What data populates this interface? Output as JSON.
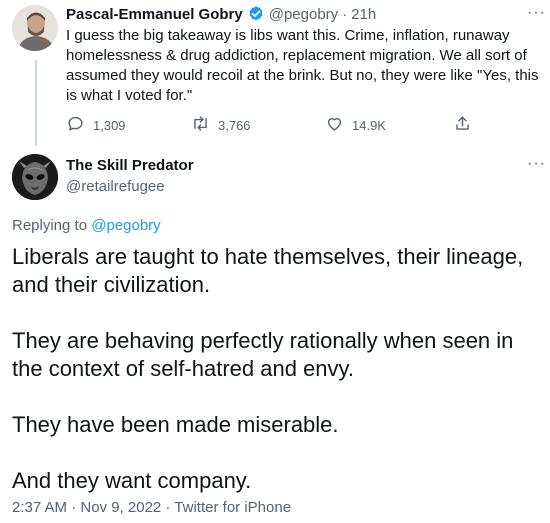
{
  "parent_tweet": {
    "author_name": "Pascal-Emmanuel Gobry",
    "handle": "@pegobry",
    "separator": "·",
    "time": "21h",
    "more": "···",
    "text": "I guess the big takeaway is libs want this. Crime, inflation, runaway homelessness & drug addiction, replacement migration. We all sort of assumed they would recoil at the brink. But no, they were like \"Yes, this is what I voted for.\"",
    "replies": "1,309",
    "retweets": "3,766",
    "likes": "14.9K"
  },
  "main_tweet": {
    "author_name": "The Skill Predator",
    "handle": "@retailrefugee",
    "more": "···",
    "replying_prefix": "Replying to",
    "replying_handle": "@pegobry",
    "paragraphs": [
      "Liberals are taught to hate themselves, their lineage, and their civilization.",
      "They are behaving perfectly rationally when seen in the context of self-hatred and envy.",
      "They have been made miserable.",
      "And they want company."
    ],
    "timestamp": "2:37 AM · Nov 9, 2022 · Twitter for iPhone"
  },
  "colors": {
    "verified_blue": "#1d9bf0",
    "secondary_text": "#536471",
    "thread_line": "#cfd9de"
  }
}
